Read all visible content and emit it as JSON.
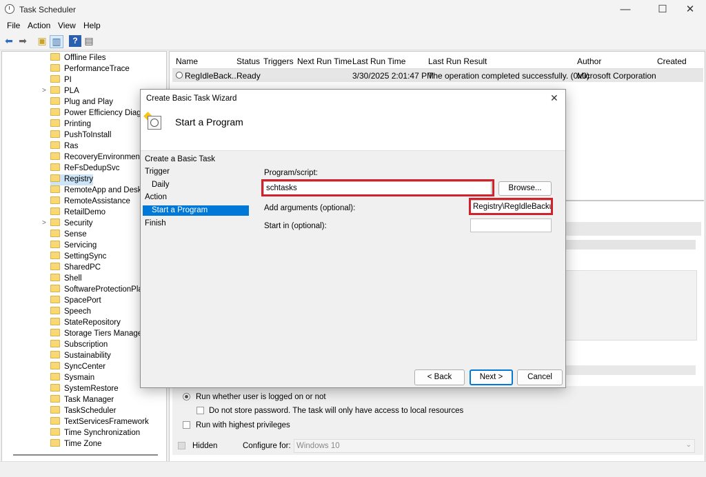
{
  "window": {
    "title": "Task Scheduler",
    "min": "—",
    "max": "☐",
    "close": "✕"
  },
  "menu": [
    "File",
    "Action",
    "View",
    "Help"
  ],
  "tree": {
    "items": [
      {
        "label": "Offline Files",
        "expander": ""
      },
      {
        "label": "PerformanceTrace",
        "expander": ""
      },
      {
        "label": "PI",
        "expander": ""
      },
      {
        "label": "PLA",
        "expander": ">"
      },
      {
        "label": "Plug and Play",
        "expander": ""
      },
      {
        "label": "Power Efficiency Diagno",
        "expander": ""
      },
      {
        "label": "Printing",
        "expander": ""
      },
      {
        "label": "PushToInstall",
        "expander": ""
      },
      {
        "label": "Ras",
        "expander": ""
      },
      {
        "label": "RecoveryEnvironment",
        "expander": ""
      },
      {
        "label": "ReFsDedupSvc",
        "expander": ""
      },
      {
        "label": "Registry",
        "expander": "",
        "selected": true
      },
      {
        "label": "RemoteApp and Deskto",
        "expander": ""
      },
      {
        "label": "RemoteAssistance",
        "expander": ""
      },
      {
        "label": "RetailDemo",
        "expander": ""
      },
      {
        "label": "Security",
        "expander": ">"
      },
      {
        "label": "Sense",
        "expander": ""
      },
      {
        "label": "Servicing",
        "expander": ""
      },
      {
        "label": "SettingSync",
        "expander": ""
      },
      {
        "label": "SharedPC",
        "expander": ""
      },
      {
        "label": "Shell",
        "expander": ""
      },
      {
        "label": "SoftwareProtectionPlatf",
        "expander": ""
      },
      {
        "label": "SpacePort",
        "expander": ""
      },
      {
        "label": "Speech",
        "expander": ""
      },
      {
        "label": "StateRepository",
        "expander": ""
      },
      {
        "label": "Storage Tiers Managem",
        "expander": ""
      },
      {
        "label": "Subscription",
        "expander": ""
      },
      {
        "label": "Sustainability",
        "expander": ""
      },
      {
        "label": "SyncCenter",
        "expander": ""
      },
      {
        "label": "Sysmain",
        "expander": ""
      },
      {
        "label": "SystemRestore",
        "expander": ""
      },
      {
        "label": "Task Manager",
        "expander": ""
      },
      {
        "label": "TaskScheduler",
        "expander": ""
      },
      {
        "label": "TextServicesFramework",
        "expander": ""
      },
      {
        "label": "Time Synchronization",
        "expander": ""
      },
      {
        "label": "Time Zone",
        "expander": ""
      }
    ]
  },
  "task_list": {
    "columns": [
      "Name",
      "Status",
      "Triggers",
      "Next Run Time",
      "Last Run Time",
      "Last Run Result",
      "Author",
      "Created"
    ],
    "row": {
      "name": "RegIdleBack...",
      "status": "Ready",
      "triggers": "",
      "next_run": "",
      "last_run": "3/30/2025 2:01:47 PM",
      "last_result": "The operation completed successfully. (0x0)",
      "author": "Microsoft Corporation",
      "created": ""
    }
  },
  "bottom": {
    "run_whether": "Run whether user is logged on or not",
    "no_store_pw": "Do not store password.  The task will only have access to local resources",
    "highest": "Run with highest privileges",
    "hidden": "Hidden",
    "configure_for": "Configure for:",
    "configure_value": "Windows 10"
  },
  "dialog": {
    "title": "Create Basic Task Wizard",
    "heading": "Start a Program",
    "steps": [
      {
        "label": "Create a Basic Task",
        "indent": false
      },
      {
        "label": "Trigger",
        "indent": false
      },
      {
        "label": "Daily",
        "indent": true
      },
      {
        "label": "Action",
        "indent": false
      },
      {
        "label": "Start a Program",
        "indent": true,
        "selected": true
      },
      {
        "label": "Finish",
        "indent": false
      }
    ],
    "program_label": "Program/script:",
    "program_value": "schtasks",
    "browse": "Browse...",
    "args_label": "Add arguments (optional):",
    "args_value": "Registry\\RegIdleBackup\"",
    "startin_label": "Start in (optional):",
    "startin_value": "",
    "back": "< Back",
    "next": "Next >",
    "cancel": "Cancel"
  },
  "colors": {
    "highlight": "#d3212c",
    "selection": "#0078d7"
  }
}
